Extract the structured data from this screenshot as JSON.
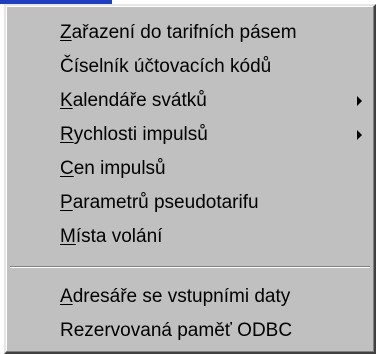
{
  "menu": {
    "items": [
      {
        "pre": "",
        "mnemonic": "Z",
        "post": "ařazení do tarifních pásem",
        "submenu": false
      },
      {
        "pre": "Číselník účtovacích kódů",
        "mnemonic": "",
        "post": "",
        "submenu": false
      },
      {
        "pre": "",
        "mnemonic": "K",
        "post": "alendáře svátků",
        "submenu": true
      },
      {
        "pre": "",
        "mnemonic": "R",
        "post": "ychlosti impulsů",
        "submenu": true
      },
      {
        "pre": "",
        "mnemonic": "C",
        "post": "en impulsů",
        "submenu": false
      },
      {
        "pre": "",
        "mnemonic": "P",
        "post": "arametrů pseudotarifu",
        "submenu": false
      },
      {
        "pre": "",
        "mnemonic": "M",
        "post": "ísta volání",
        "submenu": false
      },
      {
        "pre": "",
        "mnemonic": "A",
        "post": "dresáře se vstupními daty",
        "submenu": false
      },
      {
        "pre": "Rezervovaná paměť ODBC",
        "mnemonic": "",
        "post": "",
        "submenu": false
      }
    ]
  },
  "colors": {
    "menu_background": "#c0c0c0",
    "title_bar_fragment": "#1f3fbf",
    "text": "#000000"
  },
  "icons": {
    "submenu_arrow": "submenu-arrow-icon"
  }
}
